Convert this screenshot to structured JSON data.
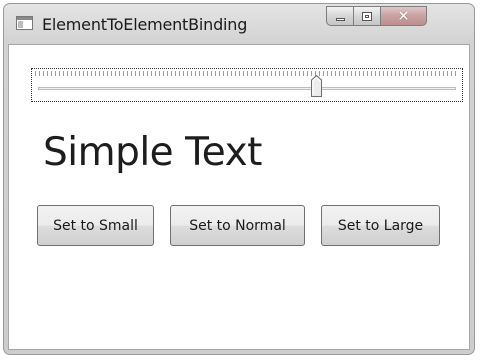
{
  "window": {
    "title": "ElementToElementBinding",
    "icons": {
      "app": "app-window-icon",
      "minimize": "minimize-icon",
      "maximize": "maximize-icon",
      "close": "close-icon"
    },
    "close_glyph": "✕"
  },
  "slider": {
    "value_fraction": 0.67
  },
  "display_text": "Simple Text",
  "buttons": {
    "small": "Set to Small",
    "normal": "Set to Normal",
    "large": "Set to Large"
  }
}
